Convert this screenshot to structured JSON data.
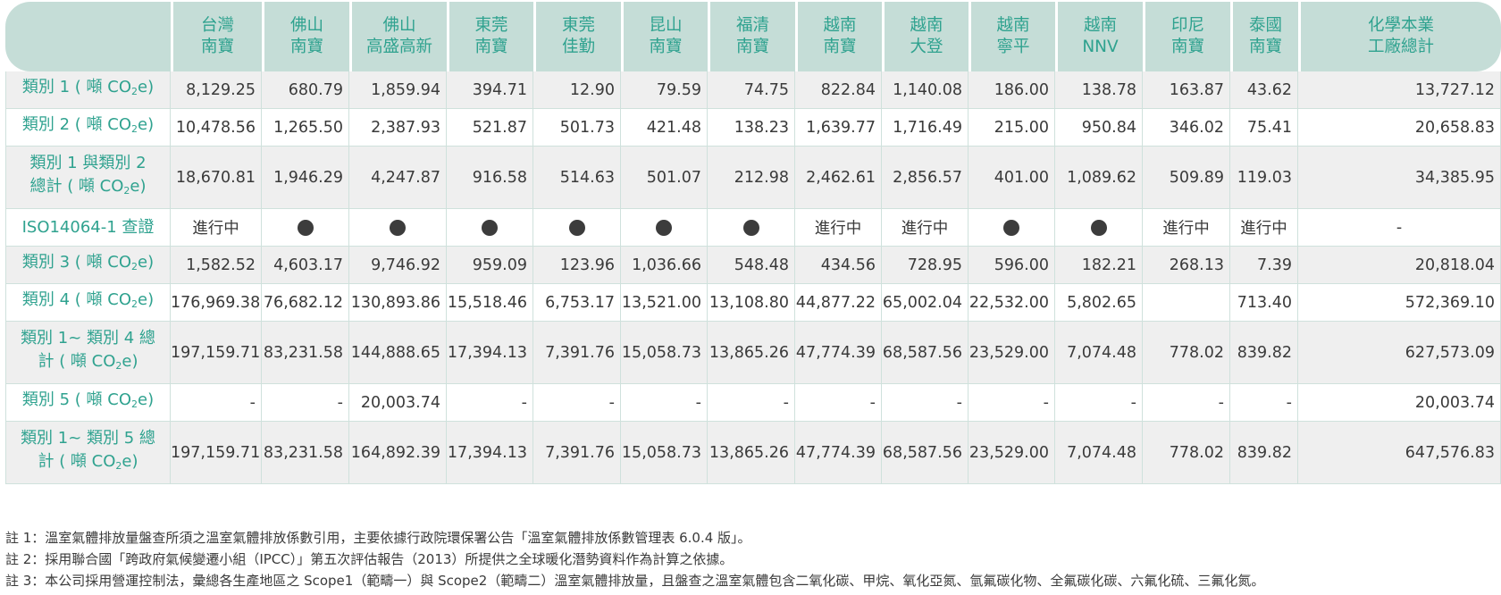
{
  "columns": [
    {
      "l1": "台灣",
      "l2": "南寶"
    },
    {
      "l1": "佛山",
      "l2": "南寶"
    },
    {
      "l1": "佛山",
      "l2": "高盛高新"
    },
    {
      "l1": "東莞",
      "l2": "南寶"
    },
    {
      "l1": "東莞",
      "l2": "佳勤"
    },
    {
      "l1": "昆山",
      "l2": "南寶"
    },
    {
      "l1": "福清",
      "l2": "南寶"
    },
    {
      "l1": "越南",
      "l2": "南寶"
    },
    {
      "l1": "越南",
      "l2": "大登"
    },
    {
      "l1": "越南",
      "l2": "寧平"
    },
    {
      "l1": "越南",
      "l2": "NNV"
    },
    {
      "l1": "印尼",
      "l2": "南寶"
    },
    {
      "l1": "泰國",
      "l2": "南寶"
    },
    {
      "l1": "化學本業",
      "l2": "工廠總計"
    }
  ],
  "rows": [
    {
      "label_a": "類別 1 ( 噸 CO",
      "label_b": "",
      "sub": "2",
      "tail": "e)",
      "values": [
        "8,129.25",
        "680.79",
        "1,859.94",
        "394.71",
        "12.90",
        "79.59",
        "74.75",
        "822.84",
        "1,140.08",
        "186.00",
        "138.78",
        "163.87",
        "43.62",
        "13,727.12"
      ]
    },
    {
      "label_a": "類別 2 ( 噸 CO",
      "label_b": "",
      "sub": "2",
      "tail": "e)",
      "values": [
        "10,478.56",
        "1,265.50",
        "2,387.93",
        "521.87",
        "501.73",
        "421.48",
        "138.23",
        "1,639.77",
        "1,716.49",
        "215.00",
        "950.84",
        "346.02",
        "75.41",
        "20,658.83"
      ]
    },
    {
      "label_a": "類別 1 與類別 2",
      "label_b": "總計 ( 噸 CO",
      "sub": "2",
      "tail": "e)",
      "values": [
        "18,670.81",
        "1,946.29",
        "4,247.87",
        "916.58",
        "514.63",
        "501.07",
        "212.98",
        "2,462.61",
        "2,856.57",
        "401.00",
        "1,089.62",
        "509.89",
        "119.03",
        "34,385.95"
      ]
    },
    {
      "label_a": "ISO14064-1 查證",
      "label_b": "",
      "sub": "",
      "tail": "",
      "values": [
        "進行中",
        "●",
        "●",
        "●",
        "●",
        "●",
        "●",
        "進行中",
        "進行中",
        "●",
        "●",
        "進行中",
        "進行中",
        "-"
      ]
    },
    {
      "label_a": "類別 3 ( 噸 CO",
      "label_b": "",
      "sub": "2",
      "tail": "e)",
      "values": [
        "1,582.52",
        "4,603.17",
        "9,746.92",
        "959.09",
        "123.96",
        "1,036.66",
        "548.48",
        "434.56",
        "728.95",
        "596.00",
        "182.21",
        "268.13",
        "7.39",
        "20,818.04"
      ]
    },
    {
      "label_a": "類別 4 ( 噸 CO",
      "label_b": "",
      "sub": "2",
      "tail": "e)",
      "values": [
        "176,969.38",
        "76,682.12",
        "130,893.86",
        "15,518.46",
        "6,753.17",
        "13,521.00",
        "13,108.80",
        "44,877.22",
        "65,002.04",
        "22,532.00",
        "5,802.65",
        "",
        "713.40",
        "572,369.10"
      ]
    },
    {
      "label_a": "類別 1~ 類別 4 總",
      "label_b": "計 ( 噸 CO",
      "sub": "2",
      "tail": "e)",
      "values": [
        "197,159.71",
        "83,231.58",
        "144,888.65",
        "17,394.13",
        "7,391.76",
        "15,058.73",
        "13,865.26",
        "47,774.39",
        "68,587.56",
        "23,529.00",
        "7,074.48",
        "778.02",
        "839.82",
        "627,573.09"
      ]
    },
    {
      "label_a": "類別 5 ( 噸 CO",
      "label_b": "",
      "sub": "2",
      "tail": "e)",
      "values": [
        "-",
        "-",
        "20,003.74",
        "-",
        "-",
        "-",
        "-",
        "-",
        "-",
        "-",
        "-",
        "-",
        "-",
        "20,003.74"
      ]
    },
    {
      "label_a": "類別 1~ 類別 5 總",
      "label_b": "計 ( 噸 CO",
      "sub": "2",
      "tail": "e)",
      "values": [
        "197,159.71",
        "83,231.58",
        "164,892.39",
        "17,394.13",
        "7,391.76",
        "15,058.73",
        "13,865.26",
        "47,774.39",
        "68,587.56",
        "23,529.00",
        "7,074.48",
        "778.02",
        "839.82",
        "647,576.83"
      ]
    }
  ],
  "notes": [
    "註 1：溫室氣體排放量盤查所須之溫室氣體排放係數引用，主要依據行政院環保署公告「溫室氣體排放係數管理表 6.0.4 版」。",
    "註 2：採用聯合國「跨政府氣候變遷小組（IPCC）」第五次評估報告（2013）所提供之全球暖化潛勢資料作為計算之依據。",
    "註 3：本公司採用營運控制法，彙總各生產地區之 Scope1（範疇一）與 Scope2（範疇二）溫室氣體排放量，且盤查之溫室氣體包含二氧化碳、甲烷、氧化亞氮、氫氟碳化物、全氟碳化碳、六氟化硫、三氟化氮。"
  ]
}
